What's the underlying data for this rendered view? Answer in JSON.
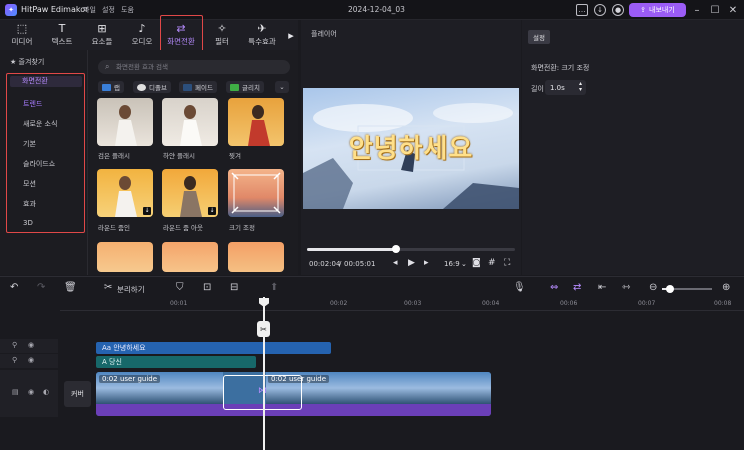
{
  "app": {
    "name": "HitPaw Edimakor",
    "menus": [
      "파일",
      "설정",
      "도움"
    ],
    "date": "2024-12-04_03",
    "export_label": "내보내기"
  },
  "toolbar": {
    "items": [
      "미디어",
      "텍스트",
      "요소들",
      "오디오",
      "화면전환",
      "필터",
      "특수효과"
    ],
    "active": "화면전환"
  },
  "sidebar": {
    "favorites": "즐겨찾기",
    "category": "화면전환",
    "items": [
      "트렌드",
      "새로운 소식",
      "기본",
      "슬라이드쇼",
      "모션",
      "효과",
      "3D"
    ],
    "active": "트렌드"
  },
  "content": {
    "search_placeholder": "화면전환 효과 검색",
    "chips": [
      "랩",
      "디졸브",
      "페이드",
      "글리치"
    ],
    "thumbs": [
      "검은 플래시",
      "하얀 플래시",
      "찢겨",
      "라운드 줌인",
      "라운드 줌 아웃",
      "크기 조정"
    ]
  },
  "player": {
    "title": "플레이어",
    "overlay_text": "안녕하세요",
    "current_time": "00:02:04",
    "total_time": "00:05:01",
    "aspect": "16:9",
    "progress": 0.43
  },
  "settings": {
    "tab": "설정",
    "heading": "화면전환: 크기 조정",
    "duration_label": "길이",
    "duration_value": "1.0s"
  },
  "timeline": {
    "split_label": "분리하기",
    "ruler": [
      "00:00",
      "00:01",
      "00:02",
      "00:03",
      "00:04",
      "00:05",
      "00:06",
      "00:07",
      "00:08"
    ],
    "title_clip": "안녕하세요",
    "text_clip": "당신",
    "video_clip_a": "0:02 user guide",
    "video_clip_b": "0:02 user guide",
    "cover_label": "커버"
  },
  "colors": {
    "accent": "#9b5cf6",
    "highlight": "#e04848",
    "title_clip": "#2563b0",
    "text_clip": "#17686a",
    "video_bar": "#6b3fb8"
  }
}
